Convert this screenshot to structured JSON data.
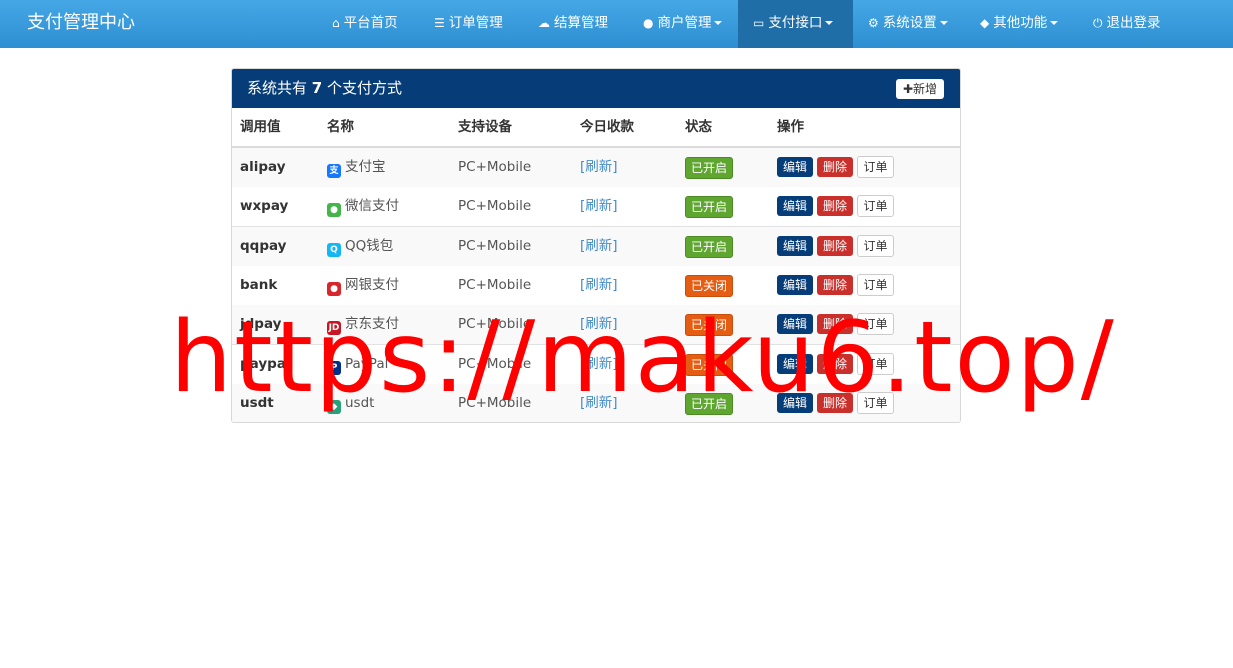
{
  "brand": "支付管理中心",
  "nav": [
    {
      "icon": "home-icon",
      "glyph": "⌂",
      "label": "平台首页",
      "caret": false
    },
    {
      "icon": "list-icon",
      "glyph": "☰",
      "label": "订单管理",
      "caret": false
    },
    {
      "icon": "cloud-icon",
      "glyph": "☁",
      "label": "结算管理",
      "caret": false
    },
    {
      "icon": "user-icon",
      "glyph": "●",
      "label": "商户管理",
      "caret": true
    },
    {
      "icon": "credit-card-icon",
      "glyph": "▭",
      "label": "支付接口",
      "caret": true,
      "active": true
    },
    {
      "icon": "gear-icon",
      "glyph": "⚙",
      "label": "系统设置",
      "caret": true
    },
    {
      "icon": "cube-icon",
      "glyph": "◆",
      "label": "其他功能",
      "caret": true
    },
    {
      "icon": "power-icon",
      "glyph": "⏻",
      "label": "退出登录",
      "caret": false
    }
  ],
  "panel": {
    "title_prefix": "系统共有 ",
    "count": "7",
    "title_suffix": " 个支付方式",
    "add_label": "新增"
  },
  "table": {
    "headers": [
      "调用值",
      "名称",
      "支持设备",
      "今日收款",
      "状态",
      "操作"
    ],
    "rows": [
      {
        "code": "alipay",
        "name": "支付宝",
        "icon": "alipay-icon",
        "device": "PC+Mobile",
        "today": "[刷新]",
        "status": "已开启",
        "on": true
      },
      {
        "code": "wxpay",
        "name": "微信支付",
        "icon": "wechat-icon",
        "device": "PC+Mobile",
        "today": "[刷新]",
        "status": "已开启",
        "on": true
      },
      {
        "code": "qqpay",
        "name": "QQ钱包",
        "icon": "qq-icon",
        "device": "PC+Mobile",
        "today": "[刷新]",
        "status": "已开启",
        "on": true
      },
      {
        "code": "bank",
        "name": "网银支付",
        "icon": "unionpay-icon",
        "device": "PC+Mobile",
        "today": "[刷新]",
        "status": "已关闭",
        "on": false
      },
      {
        "code": "jdpay",
        "name": "京东支付",
        "icon": "jd-icon",
        "device": "PC+Mobile",
        "today": "[刷新]",
        "status": "已关闭",
        "on": false
      },
      {
        "code": "paypal",
        "name": "PayPal",
        "icon": "paypal-icon",
        "device": "PC+Mobile",
        "today": "[刷新]",
        "status": "已关闭",
        "on": false
      },
      {
        "code": "usdt",
        "name": "usdt",
        "icon": "usdt-icon",
        "device": "PC+Mobile",
        "today": "[刷新]",
        "status": "已开启",
        "on": true
      }
    ],
    "actions": {
      "edit": "编辑",
      "delete": "删除",
      "order": "订单"
    }
  },
  "watermark": "https://maku6.top/",
  "colors": {
    "navbar": "#2d8fd1",
    "panel_header": "#063d78",
    "enabled": "#5fa630",
    "disabled": "#e45d12",
    "delete": "#c9302c",
    "link": "#428bca",
    "watermark": "#ff0000"
  }
}
